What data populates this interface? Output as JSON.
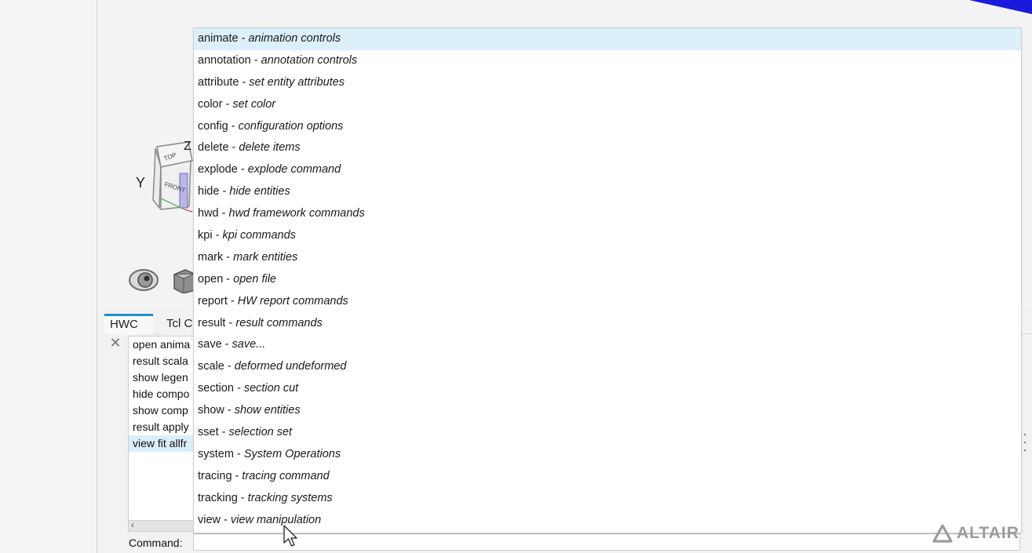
{
  "tabs": [
    {
      "label": "HWC"
    },
    {
      "label": "Tcl C"
    }
  ],
  "viewcube": {
    "axis_y": "Y",
    "axis_z": "Z",
    "face_front": "FRONT",
    "face_top": "TOP"
  },
  "history": [
    {
      "text": "open anima"
    },
    {
      "text": "result scala"
    },
    {
      "text": "show legen"
    },
    {
      "text": "hide compo"
    },
    {
      "text": "show comp"
    },
    {
      "text": "result apply"
    },
    {
      "text": "view fit allfr"
    }
  ],
  "command": {
    "label": "Command:",
    "value": ""
  },
  "suggestions": [
    {
      "cmd": "animate",
      "desc": "animation controls"
    },
    {
      "cmd": "annotation",
      "desc": "annotation controls"
    },
    {
      "cmd": "attribute",
      "desc": "set entity attributes"
    },
    {
      "cmd": "color",
      "desc": "set color"
    },
    {
      "cmd": "config",
      "desc": "configuration options"
    },
    {
      "cmd": "delete",
      "desc": "delete items"
    },
    {
      "cmd": "explode",
      "desc": "explode command"
    },
    {
      "cmd": "hide",
      "desc": "hide entities"
    },
    {
      "cmd": "hwd",
      "desc": "hwd framework commands"
    },
    {
      "cmd": "kpi",
      "desc": "kpi commands"
    },
    {
      "cmd": "mark",
      "desc": "mark entities"
    },
    {
      "cmd": "open",
      "desc": "open file"
    },
    {
      "cmd": "report",
      "desc": "HW report commands"
    },
    {
      "cmd": "result",
      "desc": "result commands"
    },
    {
      "cmd": "save",
      "desc": "save..."
    },
    {
      "cmd": "scale",
      "desc": "deformed undeformed"
    },
    {
      "cmd": "section",
      "desc": "section cut"
    },
    {
      "cmd": "show",
      "desc": "show entities"
    },
    {
      "cmd": "sset",
      "desc": "selection set"
    },
    {
      "cmd": "system",
      "desc": "System Operations"
    },
    {
      "cmd": "tracing",
      "desc": "tracing command"
    },
    {
      "cmd": "tracking",
      "desc": "tracking systems"
    },
    {
      "cmd": "view",
      "desc": "view manipulation"
    }
  ],
  "separator": " - ",
  "brand": {
    "name": "ALTAIR"
  },
  "colors": {
    "accent": "#1f8fd1",
    "highlight": "#dcf0fb",
    "corner": "#1a1adb"
  }
}
